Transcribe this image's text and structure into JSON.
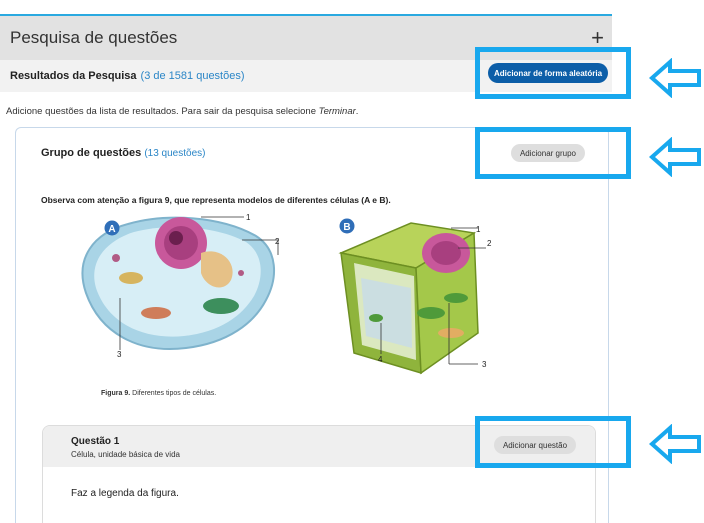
{
  "panel": {
    "title": "Pesquisa de questões",
    "plus_icon": "+"
  },
  "results": {
    "title": "Resultados da Pesquisa",
    "count": "(3 de 1581 questões)",
    "random_button": "Adicionar de forma aleatória"
  },
  "instructions": {
    "text": "Adicione questões da lista de resultados. Para sair da pesquisa selecione ",
    "terminate": "Terminar",
    "end": "."
  },
  "group": {
    "title": "Grupo de questões",
    "count": "(13 questões)",
    "add_button": "Adicionar grupo",
    "prompt": "Observa com atenção a figura 9, que representa modelos de diferentes células (A e B).",
    "figure": {
      "label_a": "A",
      "label_b": "B",
      "callouts_a": [
        "1",
        "2",
        "3"
      ],
      "callouts_b": [
        "1",
        "2",
        "3",
        "4"
      ],
      "caption_bold": "Figura 9.",
      "caption_text": " Diferentes tipos de células."
    }
  },
  "question": {
    "number": "Questão 1",
    "topic": "Célula, unidade básica de vida",
    "add_button": "Adicionar questão",
    "body": "Faz a legenda da figura."
  },
  "colors": {
    "highlight": "#18a8ee",
    "primary_button": "#0c5ea8",
    "link_blue": "#2b86c7"
  }
}
